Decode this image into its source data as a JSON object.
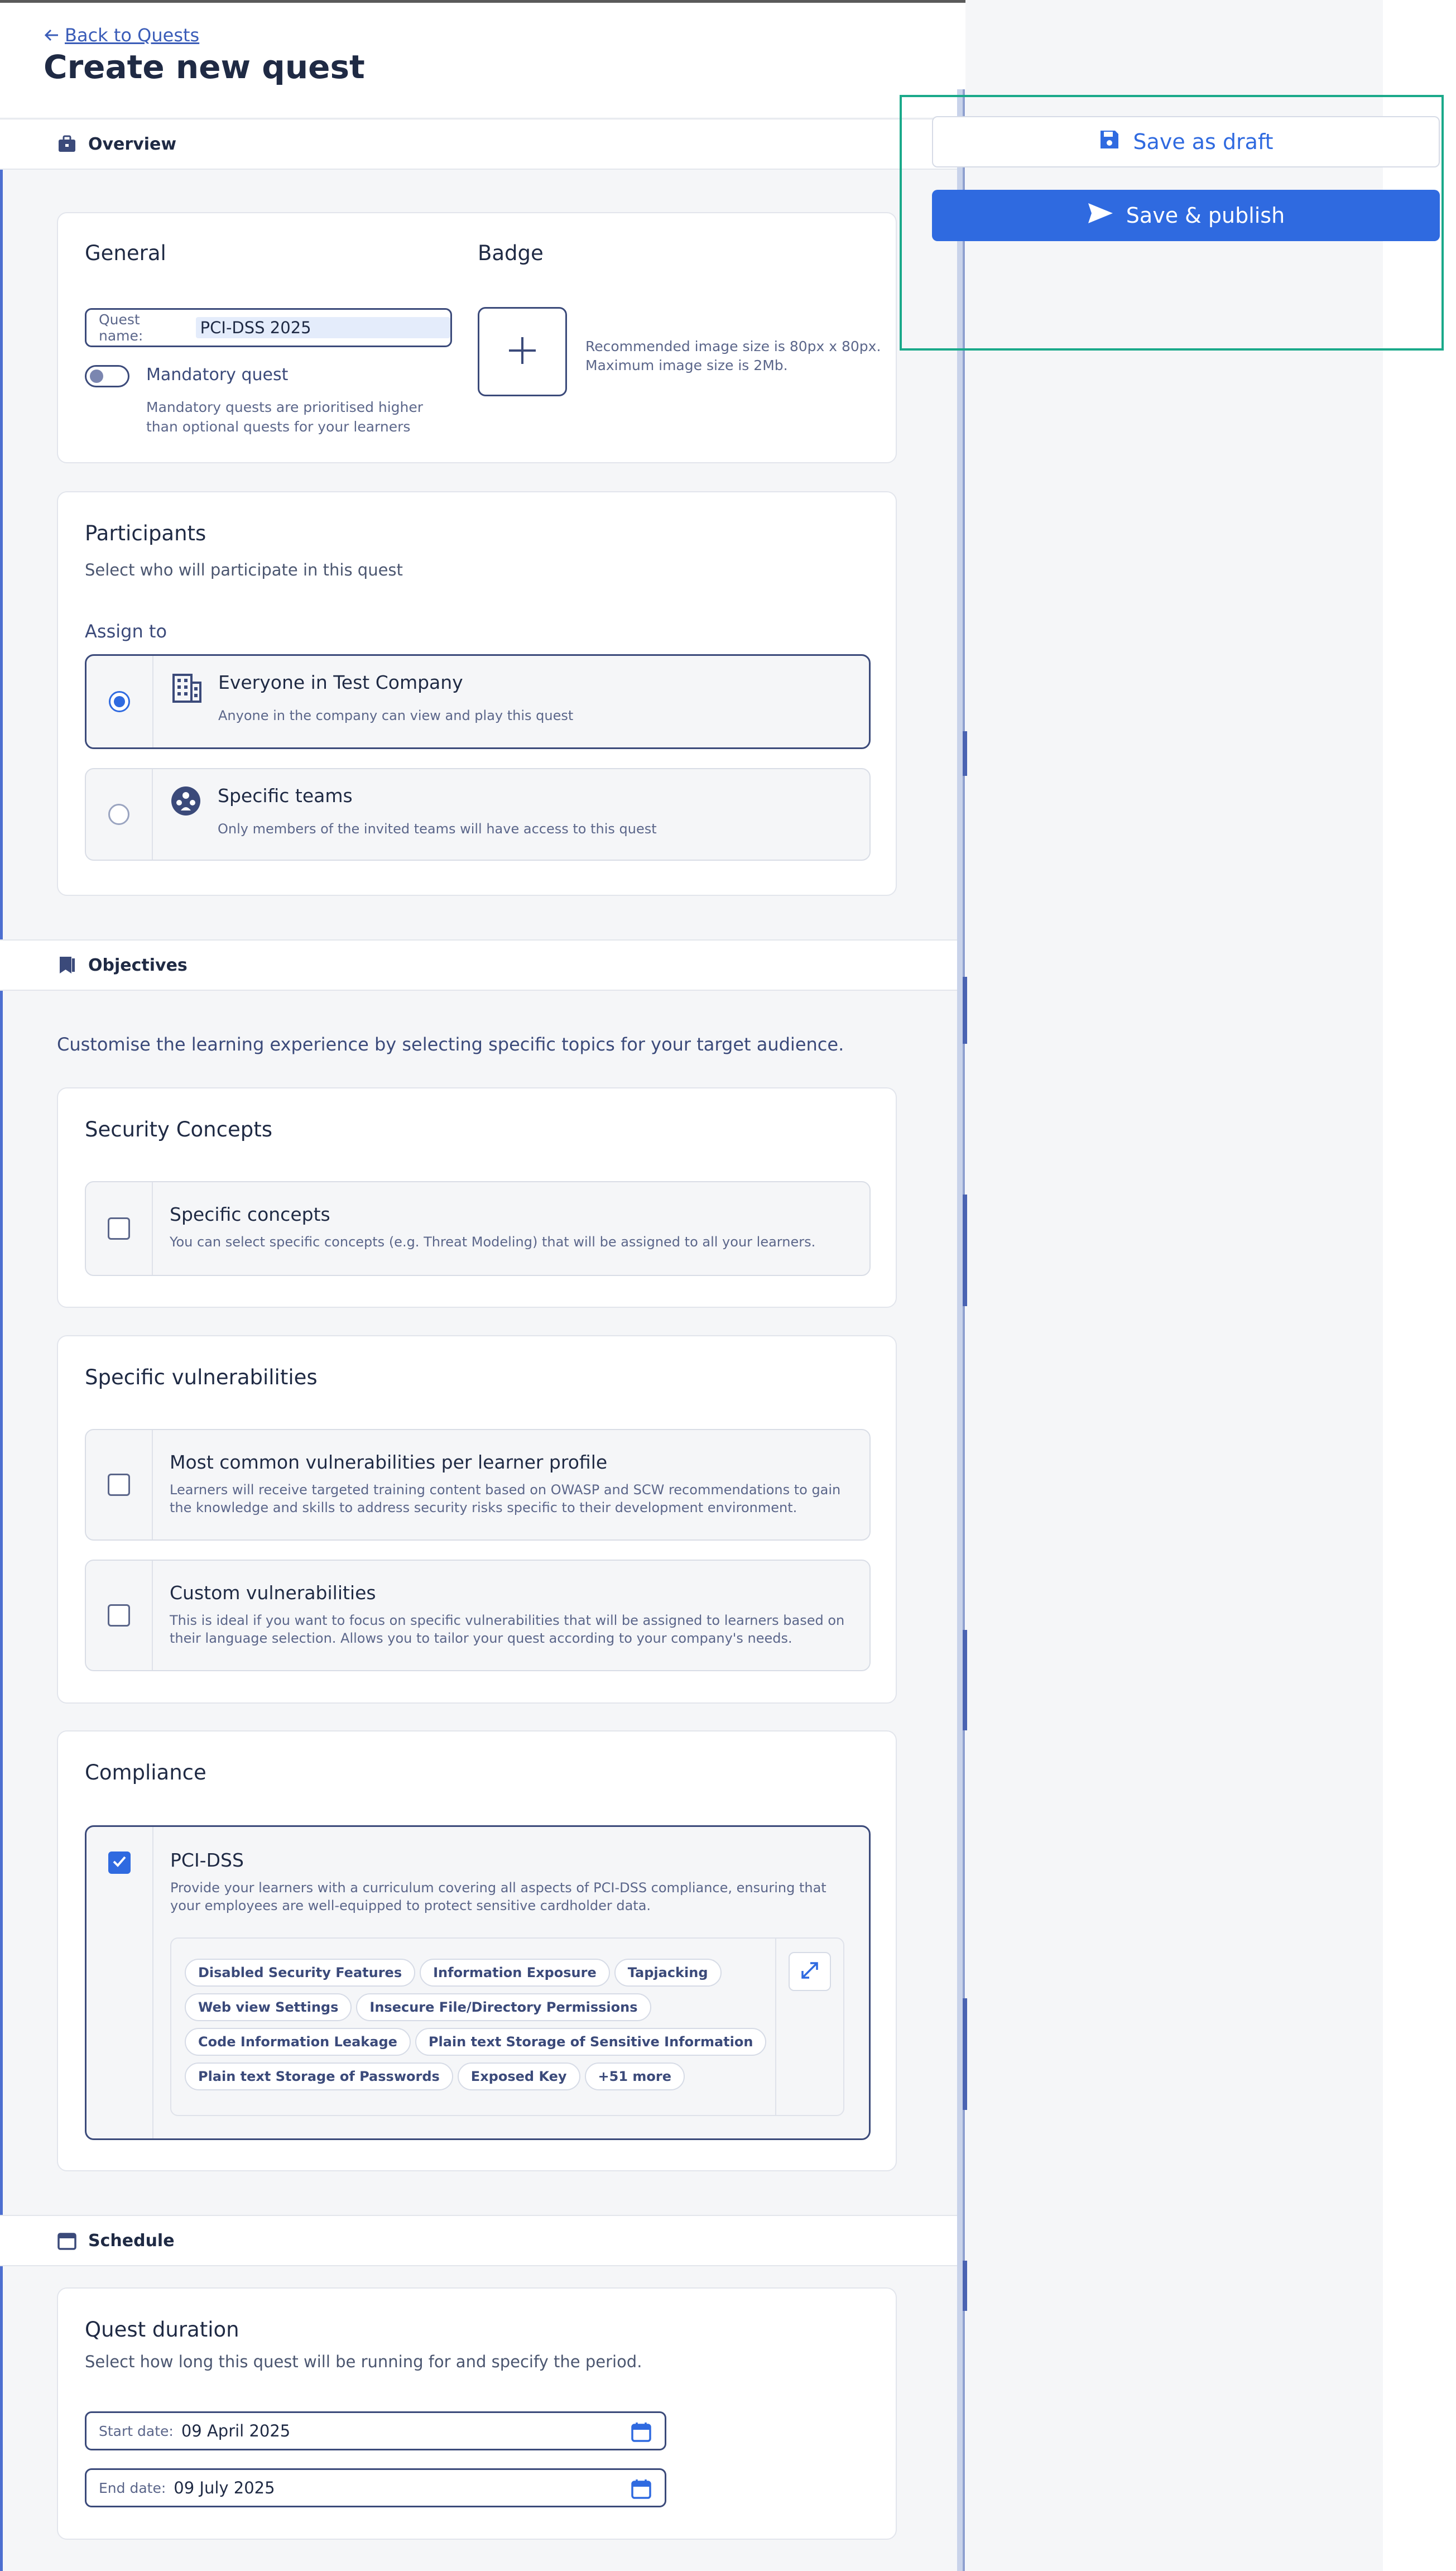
{
  "header": {
    "back_label": "Back to Quests",
    "title": "Create new quest"
  },
  "actions": {
    "save_draft": "Save as draft",
    "publish": "Save & publish"
  },
  "sections": {
    "overview": "Overview",
    "objectives": "Objectives",
    "schedule": "Schedule"
  },
  "general": {
    "title": "General",
    "quest_name_label": "Quest name:",
    "quest_name_value": "PCI-DSS 2025",
    "mandatory_label": "Mandatory quest",
    "mandatory_on": false,
    "mandatory_help": "Mandatory quests are prioritised higher than optional quests for your learners"
  },
  "badge": {
    "title": "Badge",
    "help_line1": "Recommended image size is 80px x 80px.",
    "help_line2": "Maximum image size is 2Mb."
  },
  "participants": {
    "title": "Participants",
    "subtitle": "Select who will participate in this quest",
    "assign_label": "Assign to",
    "options": [
      {
        "title": "Everyone in Test Company",
        "desc": "Anyone in the company can view and play this quest",
        "icon": "building-icon",
        "selected": true
      },
      {
        "title": "Specific teams",
        "desc": "Only members of the invited teams will have access to this quest",
        "icon": "team-icon",
        "selected": false
      }
    ]
  },
  "objectives": {
    "intro": "Customise the learning experience by selecting specific topics for your target audience.",
    "security_concepts": {
      "title": "Security Concepts",
      "option_title": "Specific concepts",
      "option_desc": "You can select specific concepts (e.g. Threat Modeling) that will be assigned to all your learners."
    },
    "vulnerabilities": {
      "title": "Specific vulnerabilities",
      "opt1_title": "Most common vulnerabilities per learner profile",
      "opt1_desc": "Learners will receive targeted training content based on OWASP and SCW recommendations to gain the knowledge and skills to address security risks specific to their development environment.",
      "opt2_title": "Custom vulnerabilities",
      "opt2_desc": "This is ideal if you want to focus on specific vulnerabilities that will be assigned to learners based on their language selection. Allows you to tailor your quest according to your company's needs."
    },
    "compliance": {
      "title": "Compliance",
      "option_title": "PCI-DSS",
      "option_desc": "Provide your learners with a curriculum covering all aspects of PCI-DSS compliance, ensuring that your employees are well-equipped to protect sensitive cardholder data.",
      "checked": true,
      "chips": [
        [
          "Disabled Security Features",
          "Information Exposure",
          "Tapjacking"
        ],
        [
          "Web view Settings",
          "Insecure File/Directory Permissions"
        ],
        [
          "Code Information Leakage",
          "Plain text Storage of Sensitive Information"
        ],
        [
          "Plain text Storage of Passwords",
          "Exposed Key",
          "+51 more"
        ]
      ]
    }
  },
  "schedule": {
    "title": "Quest duration",
    "subtitle": "Select how long this quest will be running for and specify the period.",
    "start_label": "Start date:",
    "start_value": "09 April 2025",
    "end_label": "End date:",
    "end_value": "09 July 2025"
  },
  "colors": {
    "accent": "#2f6ae0",
    "navy": "#3b4a7a",
    "highlight": "#1aa98a"
  }
}
